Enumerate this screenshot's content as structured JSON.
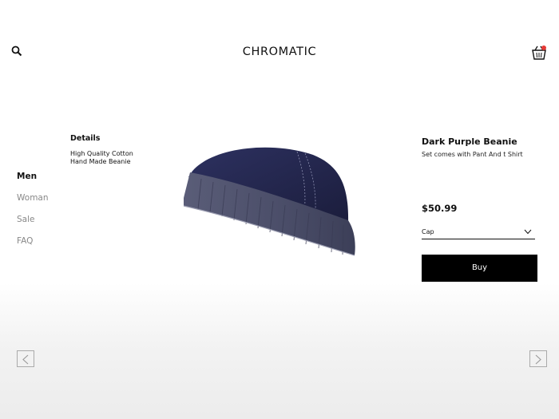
{
  "header": {
    "brand": "CHROMATIC",
    "search_icon": "search-icon",
    "cart_icon": "basket-icon",
    "cart_badge_color": "#e53935"
  },
  "nav": {
    "items": [
      {
        "label": "Men",
        "active": true
      },
      {
        "label": "Woman",
        "active": false
      },
      {
        "label": "Sale",
        "active": false
      },
      {
        "label": "FAQ",
        "active": false
      }
    ]
  },
  "details": {
    "heading": "Details",
    "line1": "High Quality Cotton",
    "line2": "Hand Made Beanie"
  },
  "product": {
    "title": "Dark Purple Beanie",
    "subtitle": "Set comes with Pant And t Shirt",
    "price": "$50.99",
    "select_value": "Cap",
    "buy_label": "Buy",
    "colors": {
      "cap": "#23264a",
      "band": "#4a4d68"
    }
  },
  "pager": {
    "prev_icon": "chevron-left-icon",
    "next_icon": "chevron-right-icon"
  }
}
